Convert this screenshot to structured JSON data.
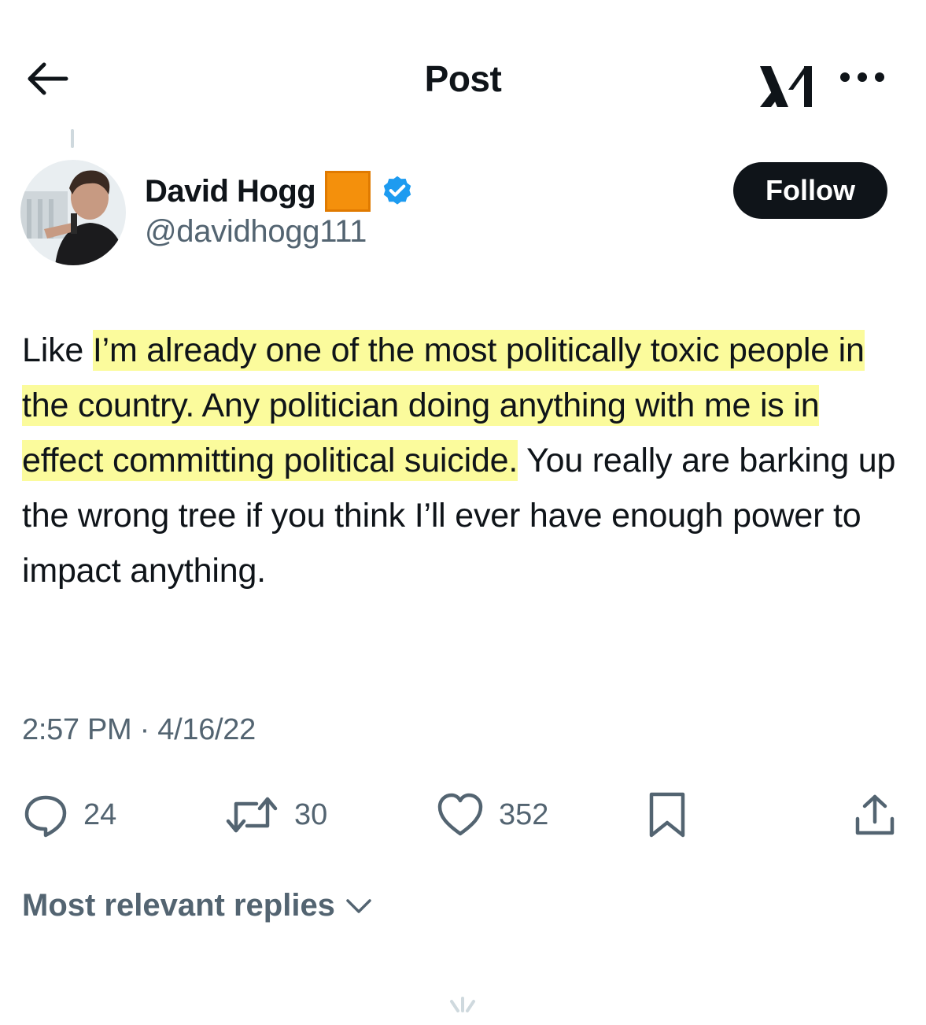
{
  "header": {
    "title": "Post"
  },
  "author": {
    "display_name": "David Hogg",
    "handle": "@davidhogg111",
    "follow_label": "Follow"
  },
  "tweet": {
    "text_plain_start": "Like ",
    "text_highlighted": "I’m already one of the most politically toxic people in the country. Any politician doing anything with me is in effect committing political suicide.",
    "text_plain_end": " You really are barking up the wrong tree if you think I’ll ever have enough power to impact anything.",
    "timestamp": "2:57 PM · 4/16/22"
  },
  "actions": {
    "replies": "24",
    "reposts": "30",
    "likes": "352"
  },
  "replies_sort": {
    "label": "Most relevant replies"
  },
  "icons": {
    "back": "arrow-left-icon",
    "grok": "grok-icon",
    "more": "more-horizontal-icon",
    "verified": "verified-badge-icon",
    "reply": "reply-bubble-icon",
    "repost": "repost-icon",
    "like": "heart-icon",
    "bookmark": "bookmark-icon",
    "share": "share-icon",
    "chevron": "chevron-down-icon"
  },
  "colors": {
    "text": "#0f1419",
    "secondary": "#536471",
    "verified": "#1d9bf0",
    "highlight": "#fbfb9c",
    "badge": "#f4900c"
  }
}
